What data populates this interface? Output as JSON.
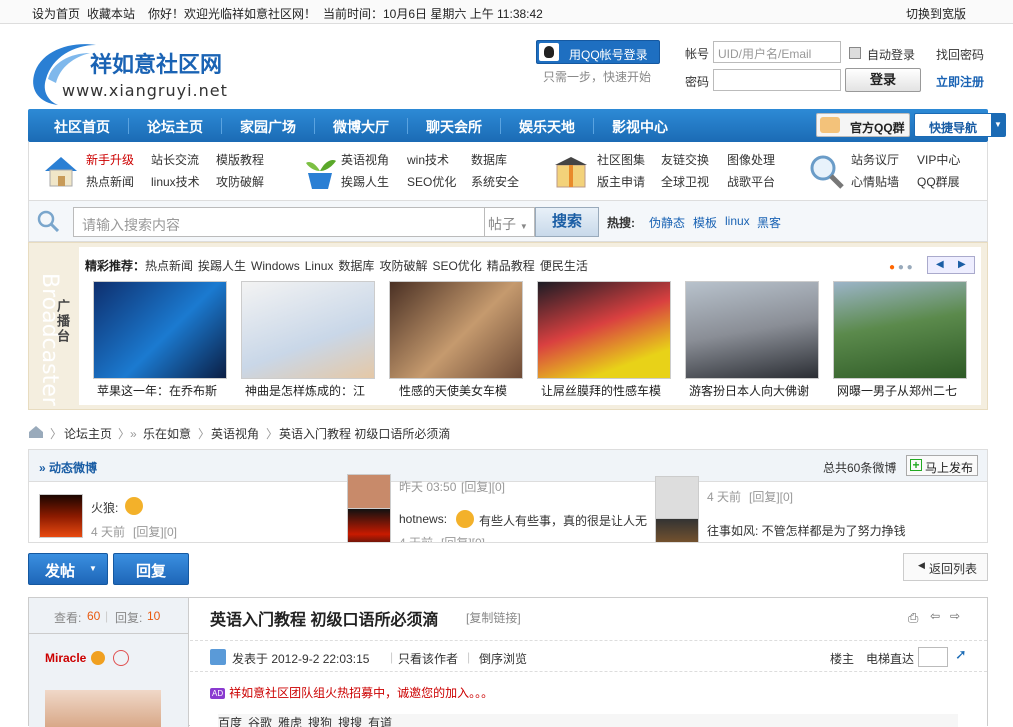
{
  "topbar": {
    "set_home": "设为首页",
    "bookmark": "收藏本站",
    "welcome": "你好！欢迎光临祥如意社区网！",
    "time": "当前时间：10月6日  星期六  上午  11:38:42",
    "wide": "切换到宽版"
  },
  "header": {
    "logo_cn": "祥如意社区网",
    "logo_url": "www.xiangruyi.net",
    "qq_login": "用QQ帐号登录",
    "qq_hint": "只需一步，快速开始",
    "account_label": "帐号",
    "account_placeholder": "UID/用户名/Email",
    "password_label": "密码",
    "auto_login": "自动登录",
    "find_pwd": "找回密码",
    "login_btn": "登录",
    "register": "立即注册"
  },
  "nav": {
    "items": [
      "社区首页",
      "论坛主页",
      "家园广场",
      "微博大厅",
      "聊天会所",
      "娱乐天地",
      "影视中心"
    ],
    "qq_group": "官方QQ群",
    "quick_nav": "快捷导航"
  },
  "cats": {
    "g1": [
      "新手升级",
      "站长交流",
      "模版教程",
      "热点新闻",
      "linux技术",
      "攻防破解"
    ],
    "g2": [
      "英语视角",
      "win技术",
      "数据库",
      "挨踢人生",
      "SEO优化",
      "系统安全"
    ],
    "g3": [
      "社区图集",
      "友链交换",
      "图像处理",
      "版主申请",
      "全球卫视",
      "战歌平台"
    ],
    "g4": [
      "站务议厅",
      "VIP中心",
      "心情贴墙",
      "QQ群展"
    ]
  },
  "search": {
    "placeholder": "请输入搜索内容",
    "type": "帖子",
    "button": "搜索",
    "hot_label": "热搜:",
    "hot": [
      "伪静态",
      "模板",
      "linux",
      "黑客"
    ]
  },
  "broadcaster": {
    "side_en": "Broadcaster",
    "side_cn": "广播台",
    "rec_label": "精彩推荐：",
    "rec_items": [
      "热点新闻",
      "挨踢人生",
      "Windows",
      "Linux",
      "数据库",
      "攻防破解",
      "SEO优化",
      "精品教程",
      "便民生活"
    ],
    "captions": [
      "苹果这一年：在乔布斯",
      "神曲是怎样炼成的：江",
      "性感的天使美女车模",
      "让屌丝膜拜的性感车模",
      "游客扮日本人向大佛谢",
      "网曝一男子从郑州二七"
    ]
  },
  "crumb": {
    "items": [
      "论坛主页",
      "乐在如意",
      "英语视角",
      "英语入门教程  初级口语所必须滴"
    ]
  },
  "weibo": {
    "title": "» 动态微博",
    "count": "总共60条微博",
    "publish": "马上发布",
    "e1_user": "火狼:",
    "e1_time": "4 天前",
    "e1_reply": "[回复][0]",
    "e2_time": "昨天 03:50",
    "e2_reply": "[回复][0]",
    "e3_user": "hotnews:",
    "e3_text": "有些人有些事，真的很是让人无",
    "e3_time": "4 天前",
    "e3_reply": "[回复][0]",
    "e4_time": "4 天前",
    "e4_reply": "[回复][0]",
    "e5_text": "往事如风: 不管怎样都是为了努力挣钱"
  },
  "actions": {
    "post": "发帖",
    "reply": "回复",
    "back": "返回列表"
  },
  "post": {
    "views_label": "查看:",
    "views": "60",
    "replies_label": "回复:",
    "replies": "10",
    "author": "Miracle",
    "title": "英语入门教程  初级口语所必须滴",
    "copy": "[复制链接]",
    "posted": "发表于  2012-9-2 22:03:15",
    "only_author": "只看该作者",
    "reverse": "倒序浏览",
    "floor": "楼主",
    "elevator": "电梯直达",
    "ad": "祥如意社区团队组火热招募中，诚邀您的加入。。。",
    "ad_tag": "AD",
    "links": [
      "百度",
      "谷歌",
      "雅虎",
      "搜狗",
      "搜搜",
      "有道"
    ]
  },
  "colors": {
    "brand": "#1b6bb5",
    "nav_bg": "#2d8ad6",
    "accent_red": "#c00"
  }
}
